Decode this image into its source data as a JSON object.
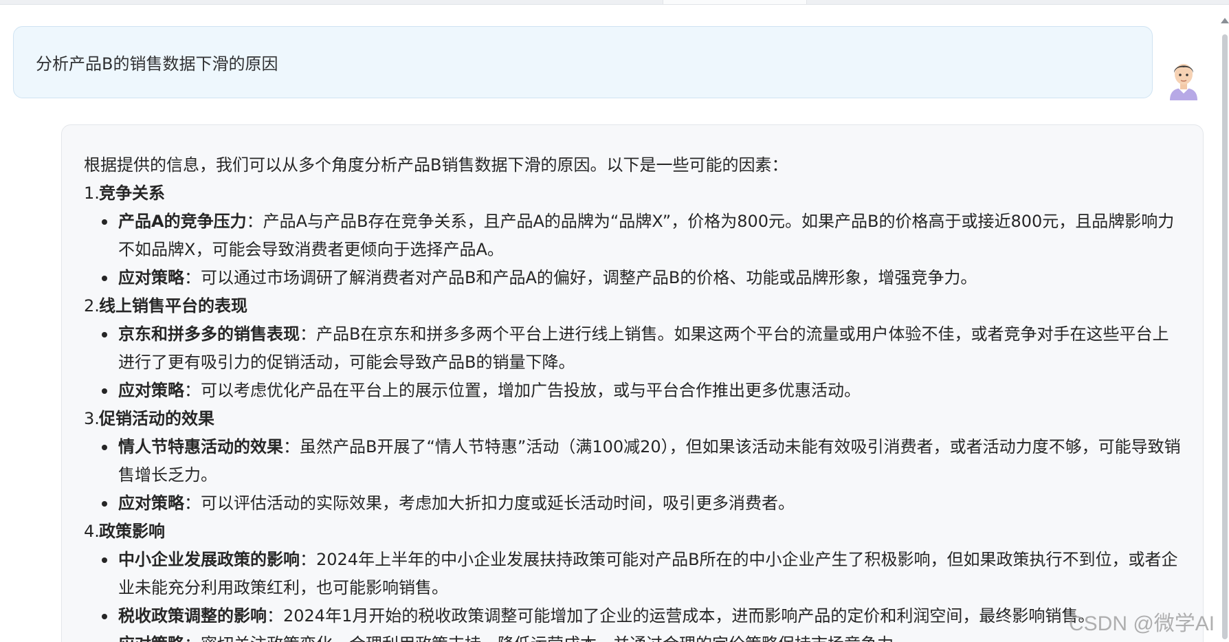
{
  "user_message": {
    "text": "分析产品B的销售数据下滑的原因"
  },
  "answer": {
    "intro": "根据提供的信息，我们可以从多个角度分析产品B销售数据下滑的原因。以下是一些可能的因素：",
    "sections": [
      {
        "number": "1.",
        "title": "竞争关系",
        "points": [
          {
            "label": "产品A的竞争压力",
            "sep": "：",
            "text": "产品A与产品B存在竞争关系，且产品A的品牌为“品牌X”，价格为800元。如果产品B的价格高于或接近800元，且品牌影响力不如品牌X，可能会导致消费者更倾向于选择产品A。"
          },
          {
            "label": "应对策略",
            "sep": "：",
            "text": "可以通过市场调研了解消费者对产品B和产品A的偏好，调整产品B的价格、功能或品牌形象，增强竞争力。"
          }
        ]
      },
      {
        "number": "2.",
        "title": "线上销售平台的表现",
        "points": [
          {
            "label": "京东和拼多多的销售表现",
            "sep": "：",
            "text": "产品B在京东和拼多多两个平台上进行线上销售。如果这两个平台的流量或用户体验不佳，或者竞争对手在这些平台上进行了更有吸引力的促销活动，可能会导致产品B的销量下降。"
          },
          {
            "label": "应对策略",
            "sep": "：",
            "text": "可以考虑优化产品在平台上的展示位置，增加广告投放，或与平台合作推出更多优惠活动。"
          }
        ]
      },
      {
        "number": "3.",
        "title": "促销活动的效果",
        "points": [
          {
            "label": "情人节特惠活动的效果",
            "sep": "：",
            "text": "虽然产品B开展了“情人节特惠”活动（满100减20），但如果该活动未能有效吸引消费者，或者活动力度不够，可能导致销售增长乏力。"
          },
          {
            "label": "应对策略",
            "sep": "：",
            "text": "可以评估活动的实际效果，考虑加大折扣力度或延长活动时间，吸引更多消费者。"
          }
        ]
      },
      {
        "number": "4.",
        "title": "政策影响",
        "points": [
          {
            "label": "中小企业发展政策的影响",
            "sep": "：",
            "text": "2024年上半年的中小企业发展扶持政策可能对产品B所在的中小企业产生了积极影响，但如果政策执行不到位，或者企业未能充分利用政策红利，也可能影响销售。"
          },
          {
            "label": "税收政策调整的影响",
            "sep": "：",
            "text": "2024年1月开始的税收政策调整可能增加了企业的运营成本，进而影响产品的定价和利润空间，最终影响销售。"
          },
          {
            "label": "应对策略",
            "sep": "：",
            "text": "密切关注政策变化，合理利用政策支持，降低运营成本，并通过合理的定价策略保持市场竞争力。"
          }
        ]
      }
    ]
  },
  "watermark": "CSDN @微学AI",
  "colors": {
    "user_bubble_bg": "#eef7fd",
    "answer_card_bg": "#f7f8fa",
    "text": "#262626"
  }
}
